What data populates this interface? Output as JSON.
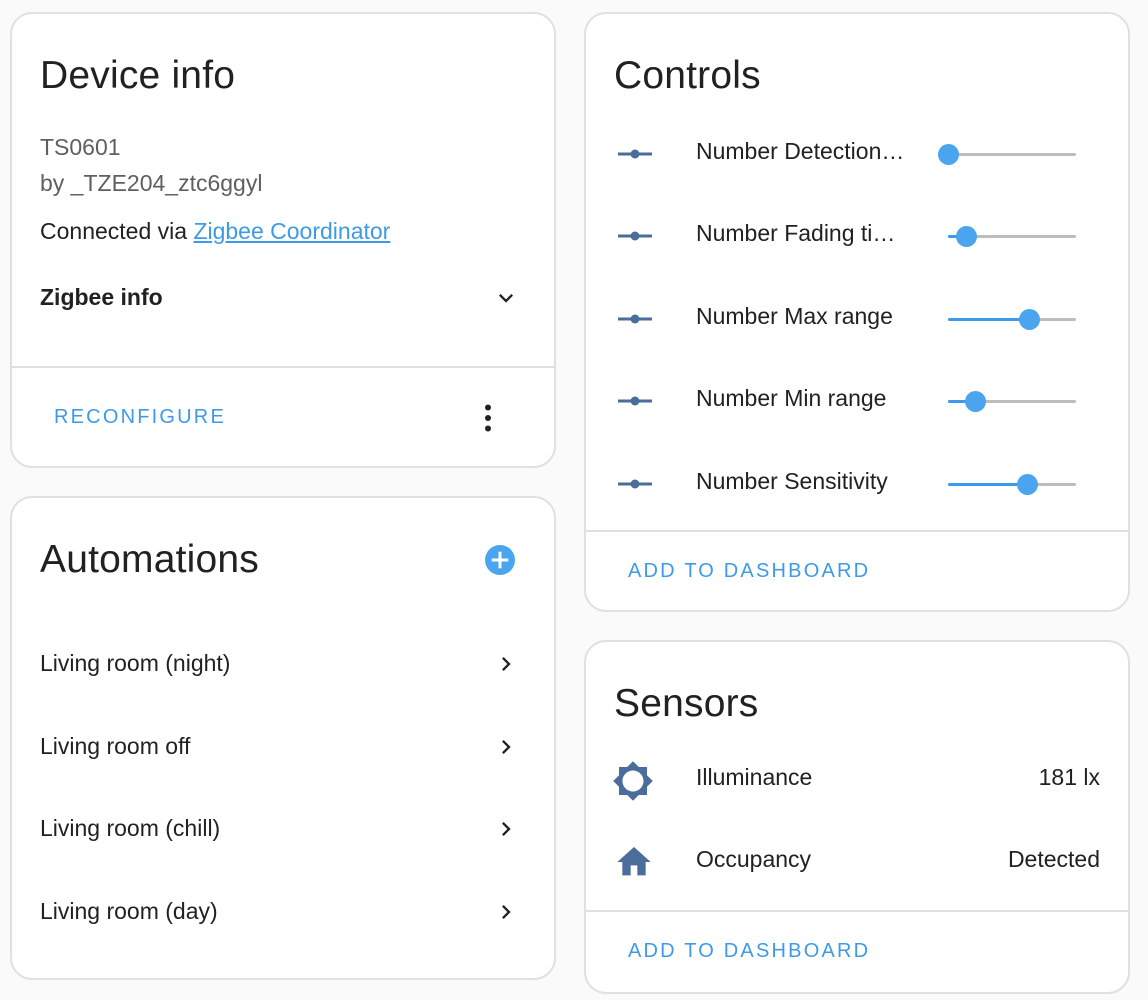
{
  "colors": {
    "accent": "#3d9ae8",
    "icon": "#4a6d9c",
    "slider_track": "#bdbdbd",
    "card_border": "#e0e0e0"
  },
  "device_info": {
    "title": "Device info",
    "model": "TS0601",
    "manufacturer": "by _TZE204_ztc6ggyl",
    "connected_prefix": "Connected via ",
    "connected_link": "Zigbee Coordinator",
    "zigbee_info_label": "Zigbee info",
    "zigbee_info_icon": "chevron-down-icon",
    "reconfigure_label": "RECONFIGURE",
    "more_icon": "dots-vertical-icon"
  },
  "automations": {
    "title": "Automations",
    "add_icon": "plus-circle-icon",
    "items": [
      {
        "label": "Living room (night)"
      },
      {
        "label": "Living room off"
      },
      {
        "label": "Living room (chill)"
      },
      {
        "label": "Living room (day)"
      }
    ]
  },
  "controls": {
    "title": "Controls",
    "row_icon": "ray-vertex-icon",
    "items": [
      {
        "label": "Number Detection…",
        "fraction": 0.0
      },
      {
        "label": "Number Fading ti…",
        "fraction": 0.14
      },
      {
        "label": "Number Max range",
        "fraction": 0.63
      },
      {
        "label": "Number Min range",
        "fraction": 0.21
      },
      {
        "label": "Number Sensitivity",
        "fraction": 0.62
      }
    ],
    "add_to_dashboard_label": "ADD TO DASHBOARD"
  },
  "sensors": {
    "title": "Sensors",
    "items": [
      {
        "label": "Illuminance",
        "value": "181 lx",
        "icon": "brightness-icon"
      },
      {
        "label": "Occupancy",
        "value": "Detected",
        "icon": "home-icon"
      }
    ],
    "add_to_dashboard_label": "ADD TO DASHBOARD"
  }
}
